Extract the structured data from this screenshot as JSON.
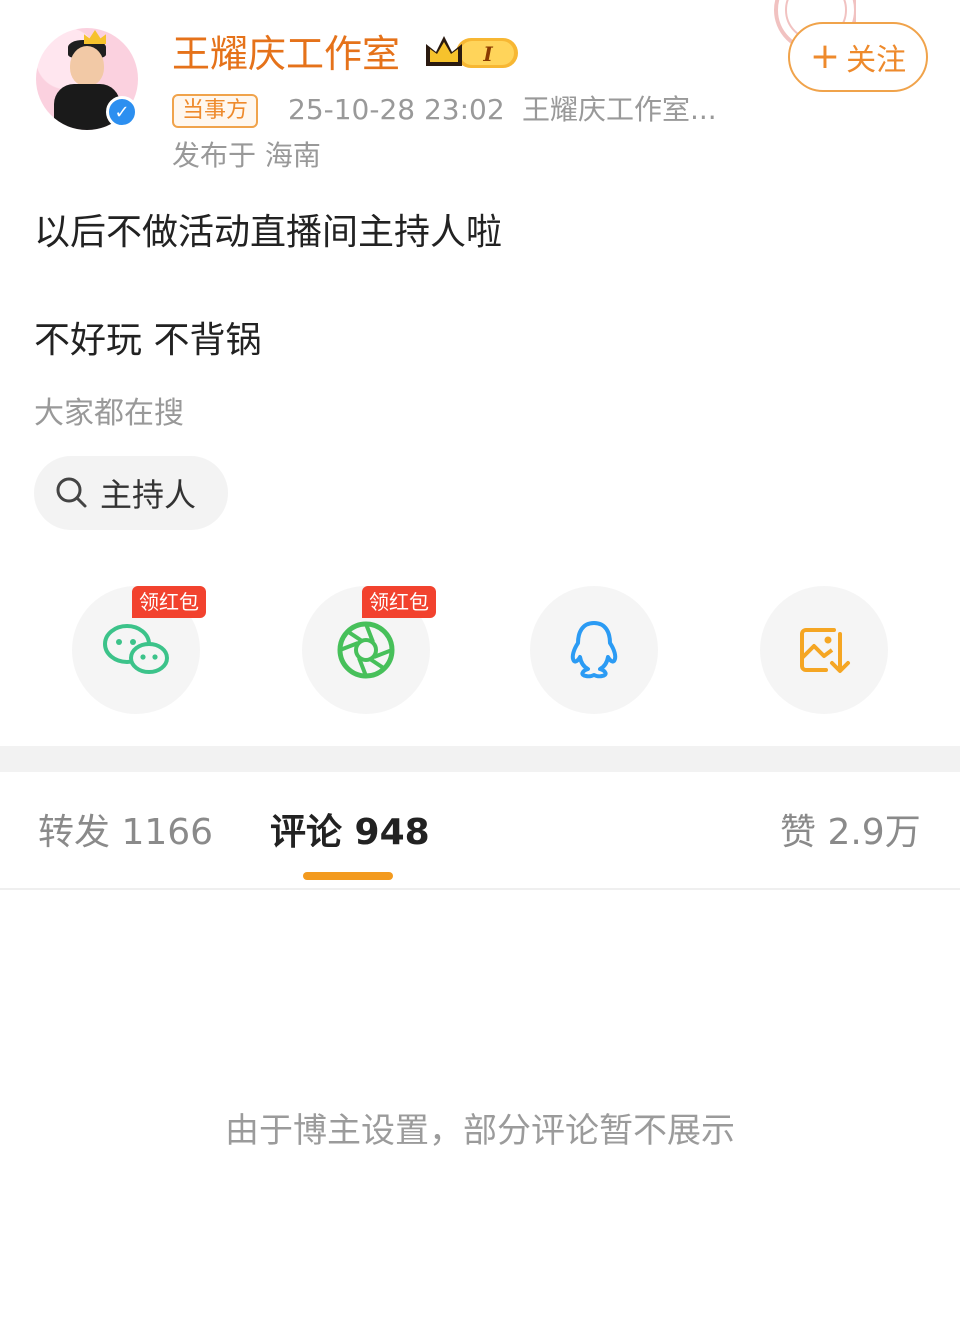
{
  "post": {
    "author": {
      "name": "王耀庆工作室",
      "member_level": "I",
      "verified": true,
      "role_tag": "当事方"
    },
    "time": "25-10-28 23:02",
    "source": "王耀庆工作室...",
    "location": "发布于 海南",
    "follow_label": "关注",
    "content": {
      "line1": "以后不做活动直播间主持人啦",
      "line2": "不好玩 不背锅"
    }
  },
  "search": {
    "label": "大家都在搜",
    "chip_text": "主持人"
  },
  "share": {
    "items": [
      {
        "name": "wechat",
        "badge": "领红包",
        "icon": "wechat-icon",
        "color": "#3cc38a"
      },
      {
        "name": "moments",
        "badge": "领红包",
        "icon": "moments-icon",
        "color": "#47c05a"
      },
      {
        "name": "qq",
        "badge": "",
        "icon": "qq-icon",
        "color": "#2b9bf4"
      },
      {
        "name": "save-image",
        "badge": "",
        "icon": "save-image-icon",
        "color": "#f5a623"
      }
    ]
  },
  "tabs": {
    "repost": "转发 1166",
    "comments": "评论 948",
    "likes": "赞 2.9万"
  },
  "notice": "由于博主设置，部分评论暂不展示",
  "colors": {
    "accent": "#ee8a2c",
    "tab_indicator": "#f39a1e",
    "hongbao_red": "#f2422e"
  }
}
